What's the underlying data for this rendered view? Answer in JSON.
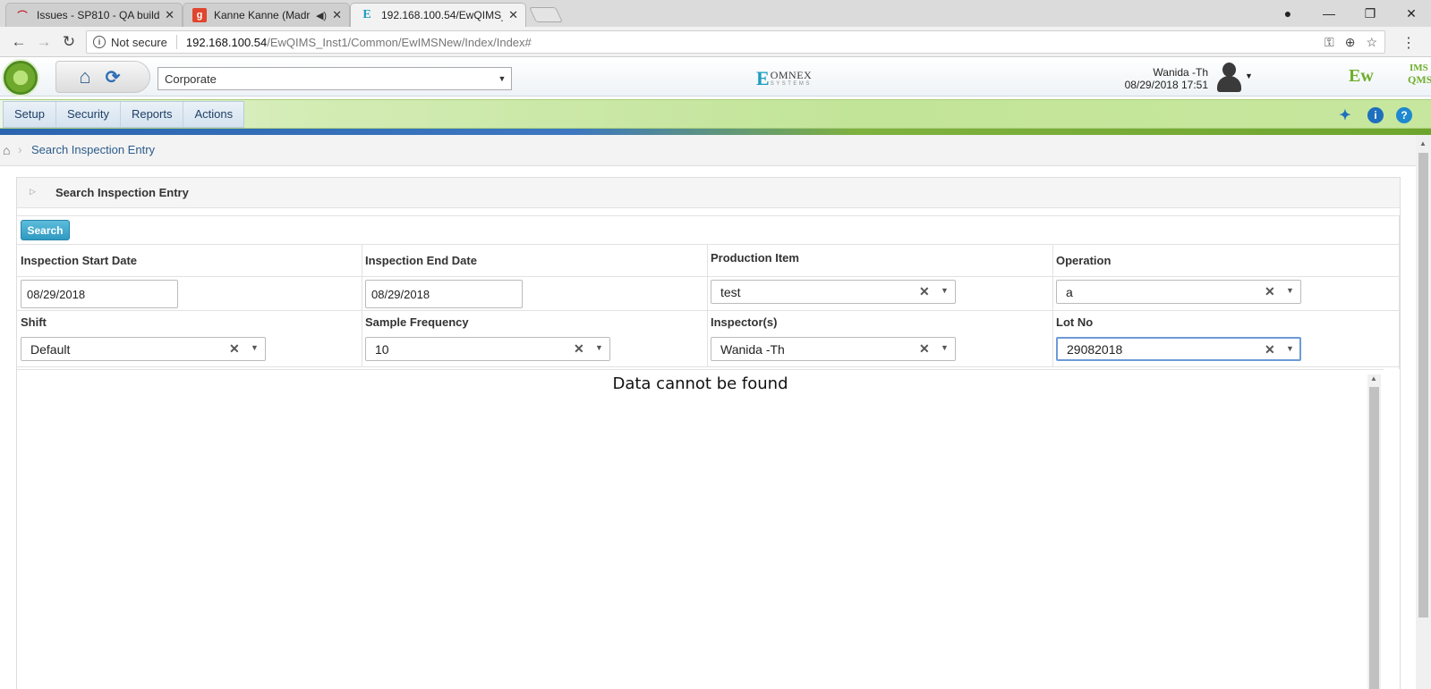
{
  "browser": {
    "tabs": [
      {
        "title": "Issues - SP810 - QA build",
        "icon": "redmine-icon"
      },
      {
        "title": "Kanne Kanne (Madras",
        "icon": "gaana-icon"
      },
      {
        "title": "192.168.100.54/EwQIMS_",
        "icon": "omnex-icon"
      }
    ],
    "address": {
      "security": "Not secure",
      "host": "192.168.100.54",
      "path": "/EwQIMS_Inst1/Common/EwIMSNew/Index/Index#"
    }
  },
  "header": {
    "plant_select": "Corporate",
    "brand": {
      "mark": "E",
      "name": "OMNEX",
      "sub": "SYSTEMS"
    },
    "user": {
      "name": "Wanida -Th",
      "datetime": "08/29/2018 17:51"
    },
    "product_logo": {
      "ew": "Ew",
      "ims": "IMS",
      "qms": "QMS"
    }
  },
  "menu": {
    "items": [
      "Setup",
      "Security",
      "Reports",
      "Actions"
    ]
  },
  "breadcrumb": {
    "current": "Search Inspection Entry"
  },
  "panel": {
    "title": "Search Inspection Entry",
    "search_label": "Search",
    "fields": {
      "start_date": {
        "label": "Inspection Start Date",
        "value": "08/29/2018"
      },
      "end_date": {
        "label": "Inspection End Date",
        "value": "08/29/2018"
      },
      "production_item": {
        "label": "Production Item",
        "value": "test"
      },
      "operation": {
        "label": "Operation",
        "value": "a"
      },
      "shift": {
        "label": "Shift",
        "value": "Default"
      },
      "sample_frequency": {
        "label": "Sample Frequency",
        "value": "10"
      },
      "inspectors": {
        "label": "Inspector(s)",
        "value": "Wanida -Th"
      },
      "lot_no": {
        "label": "Lot No",
        "value": "29082018"
      }
    },
    "empty_message": "Data cannot be found"
  },
  "colors": {
    "menu_text": "#1f3f66",
    "search_button": "#2f9ac2",
    "brand_green": "#6fae2b"
  }
}
